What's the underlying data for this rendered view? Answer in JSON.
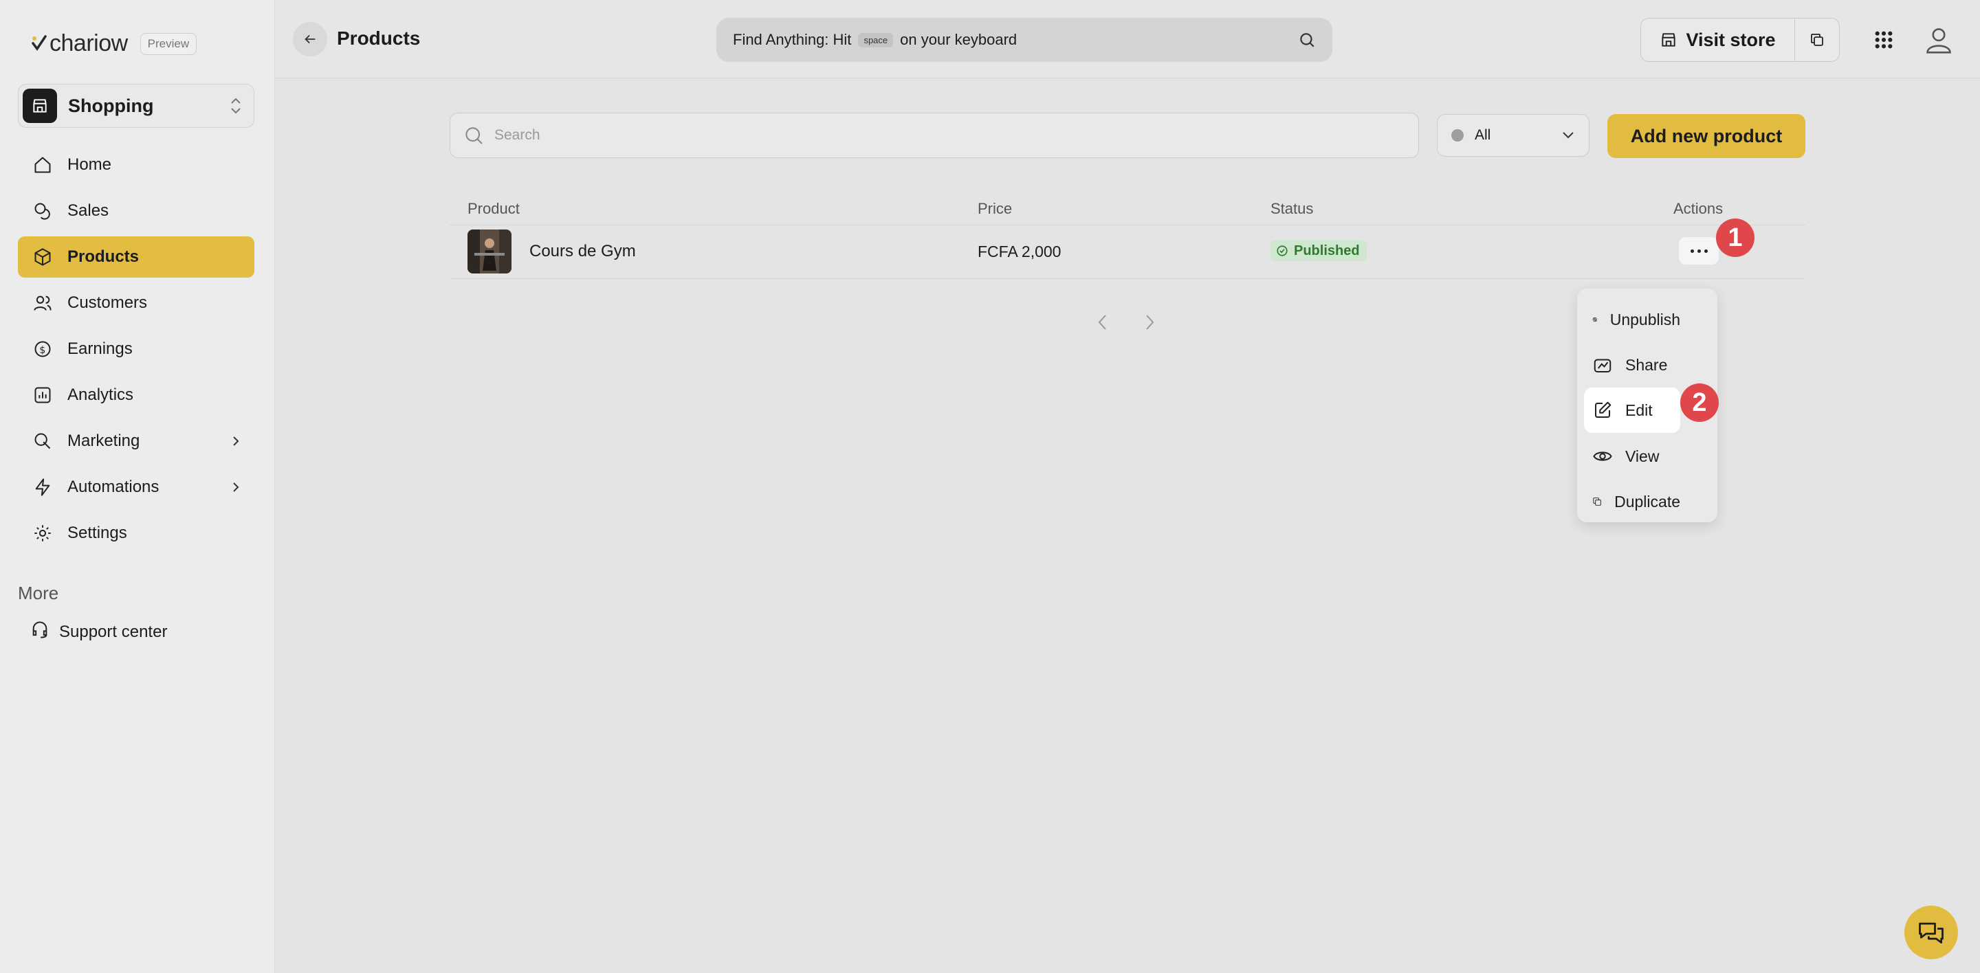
{
  "brand": {
    "name": "chariow",
    "tag": "Preview"
  },
  "workspace": {
    "name": "Shopping"
  },
  "sidebar": {
    "items": [
      {
        "label": "Home",
        "icon": "home-icon"
      },
      {
        "label": "Sales",
        "icon": "coins-icon"
      },
      {
        "label": "Products",
        "icon": "box-icon",
        "active": true
      },
      {
        "label": "Customers",
        "icon": "users-icon"
      },
      {
        "label": "Earnings",
        "icon": "earnings-icon"
      },
      {
        "label": "Analytics",
        "icon": "analytics-icon"
      },
      {
        "label": "Marketing",
        "icon": "marketing-icon",
        "has_submenu": true
      },
      {
        "label": "Automations",
        "icon": "bolt-icon",
        "has_submenu": true
      },
      {
        "label": "Settings",
        "icon": "gear-icon"
      }
    ],
    "more_title": "More",
    "support_label": "Support center"
  },
  "header": {
    "title": "Products",
    "finder_prefix": "Find Anything: Hit",
    "finder_key": "space",
    "finder_suffix": "on your keyboard",
    "visit_store_label": "Visit store"
  },
  "toolbar": {
    "search_placeholder": "Search",
    "status_filter": "All",
    "add_label": "Add new product"
  },
  "table": {
    "columns": [
      "Product",
      "Price",
      "Status",
      "Actions"
    ],
    "rows": [
      {
        "name": "Cours de Gym",
        "price": "FCFA 2,000",
        "status": "Published"
      }
    ]
  },
  "actions_menu": {
    "items": [
      "Unpublish",
      "Share",
      "Edit",
      "View",
      "Duplicate"
    ]
  },
  "markers": [
    "1",
    "2"
  ],
  "colors": {
    "accent": "#e2bc41",
    "marker": "#e0474b",
    "published_bg": "#cfe7cf",
    "published_text": "#2f7a2f"
  }
}
